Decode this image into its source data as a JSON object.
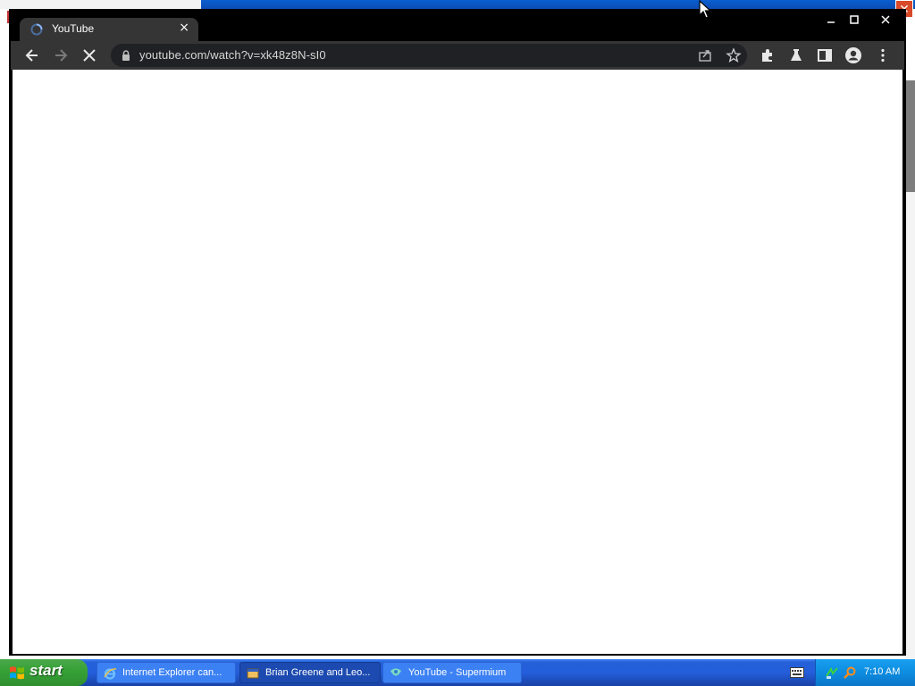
{
  "browser": {
    "tab": {
      "title": "YouTube",
      "close_glyph": "×"
    },
    "window_controls": {
      "minimize": "minimize-icon",
      "maximize": "maximize-icon",
      "close": "close-icon"
    },
    "toolbar": {
      "back": "back-arrow-icon",
      "forward": "forward-arrow-icon",
      "stop": "stop-loading-icon",
      "url": "youtube.com/watch?v=xk48z8N-sI0",
      "share": "share-icon",
      "bookmark": "star-icon",
      "extensions": "puzzle-icon",
      "labs": "flask-icon",
      "side_panel": "side-panel-icon",
      "profile": "profile-icon",
      "menu": "kebab-menu-icon"
    },
    "colors": {
      "frame": "#000000",
      "toolbar": "#353535",
      "omnibox": "#202124",
      "page": "#ffffff"
    }
  },
  "taskbar": {
    "start_label": "start",
    "tasks": [
      {
        "label": "Internet Explorer can...",
        "icon": "ie-icon",
        "active": false
      },
      {
        "label": "Brian Greene and Leo...",
        "icon": "window-icon",
        "active": true
      },
      {
        "label": "YouTube - Supermium",
        "icon": "supermium-icon",
        "active": false
      }
    ],
    "clock": "7:10 AM"
  }
}
